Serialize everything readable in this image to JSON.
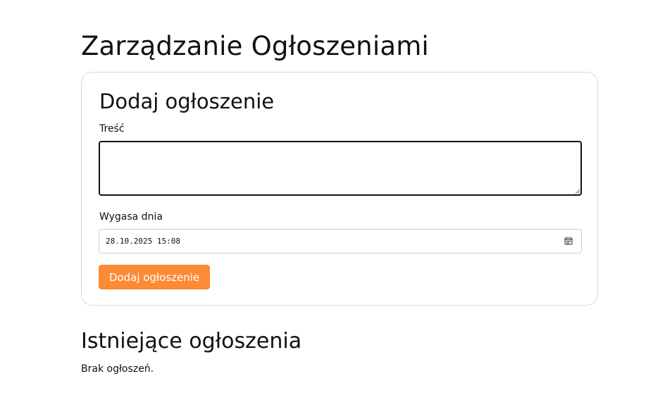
{
  "page": {
    "title": "Zarządzanie Ogłoszeniami"
  },
  "add_form": {
    "title": "Dodaj ogłoszenie",
    "content_label": "Treść",
    "content_value": "",
    "expires_label": "Wygasa dnia",
    "expires_value": "28.10.2025 15:08",
    "calendar_icon": "calendar-icon",
    "submit_label": "Dodaj ogłoszenie"
  },
  "existing": {
    "title": "Istniejące ogłoszenia",
    "empty_text": "Brak ogłoszeń."
  },
  "colors": {
    "accent": "#fd8b35",
    "card_border": "#d9d9d9",
    "text": "#111111"
  }
}
